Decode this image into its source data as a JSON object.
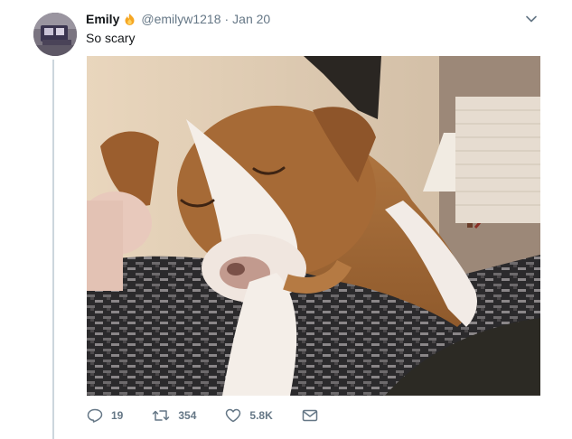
{
  "tweet": {
    "author_name": "Emily",
    "author_handle": "@emilyw1218",
    "separator": "·",
    "date": "Jan 20",
    "text": "So scary"
  },
  "actions": {
    "replies": "19",
    "retweets": "354",
    "likes": "5.8K"
  },
  "icons": {
    "name_emoji": "fire-emoji-icon",
    "caret": "chevron-down-icon",
    "reply": "reply-icon",
    "retweet": "retweet-icon",
    "like": "heart-icon",
    "message": "envelope-icon"
  },
  "colors": {
    "secondary_text": "#657786",
    "thread_line": "#ccd6dd",
    "primary_text": "#14171a"
  }
}
